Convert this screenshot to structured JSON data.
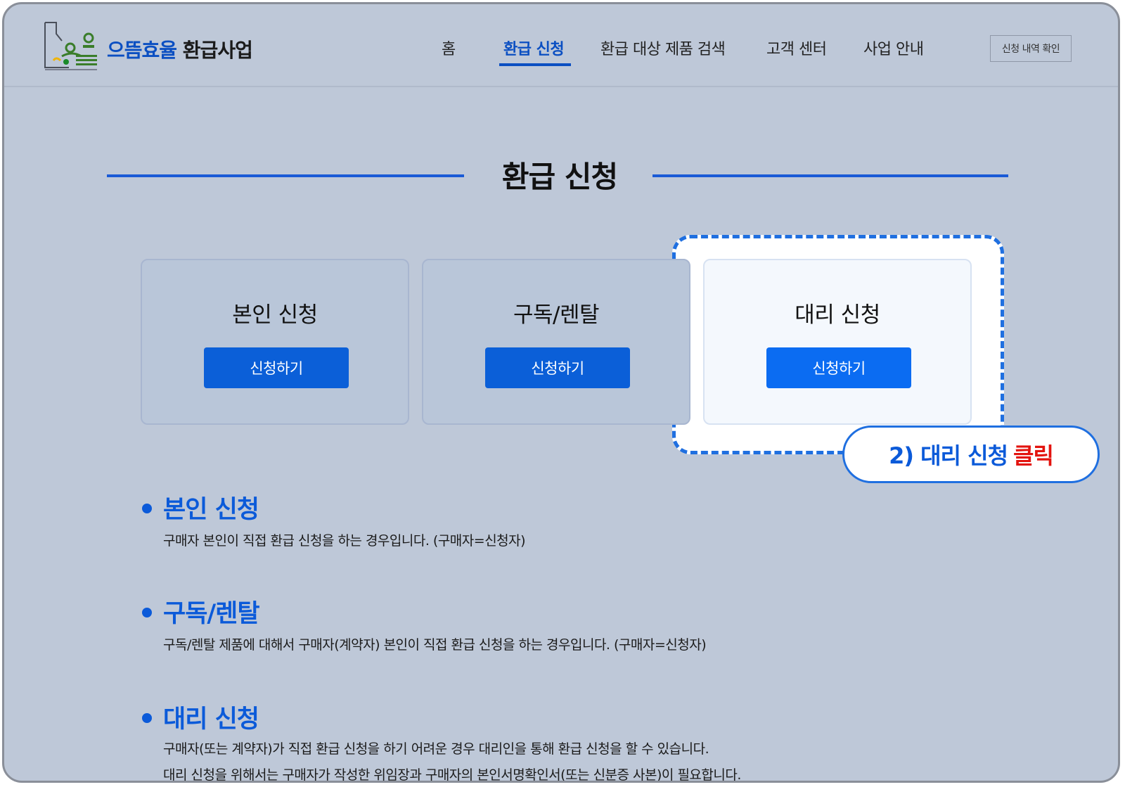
{
  "header": {
    "logo_text_1": "으뜸효율",
    "logo_text_2": "환급사업",
    "nav": [
      "홈",
      "환급 신청",
      "환급 대상 제품 검색",
      "고객 센터",
      "사업 안내"
    ],
    "history_button": "신청 내역 확인"
  },
  "section_title": "환급 신청",
  "cards": [
    {
      "title": "본인 신청",
      "button": "신청하기"
    },
    {
      "title": "구독/렌탈",
      "button": "신청하기"
    },
    {
      "title": "대리 신청",
      "button": "신청하기"
    }
  ],
  "callout": {
    "prefix": "2) 대리 신청",
    "action": "클릭"
  },
  "info": [
    {
      "title": "본인 신청",
      "lines": [
        "구매자 본인이 직접 환급 신청을 하는 경우입니다. (구매자=신청자)"
      ]
    },
    {
      "title": "구독/렌탈",
      "lines": [
        "구독/렌탈 제품에 대해서 구매자(계약자) 본인이 직접 환급 신청을 하는 경우입니다. (구매자=신청자)"
      ]
    },
    {
      "title": "대리 신청",
      "lines": [
        "구매자(또는 계약자)가 직접 환급 신청을 하기 어려운 경우 대리인을 통해 환급 신청을 할 수 있습니다.",
        "대리 신청을 위해서는 구매자가 작성한 위임장과 구매자의 본인서명확인서(또는 신분증 사본)이 필요합니다."
      ]
    }
  ],
  "colors": {
    "accent": "#0b5ad9",
    "callout_red": "#e3140f",
    "background": "#bec8d8"
  }
}
